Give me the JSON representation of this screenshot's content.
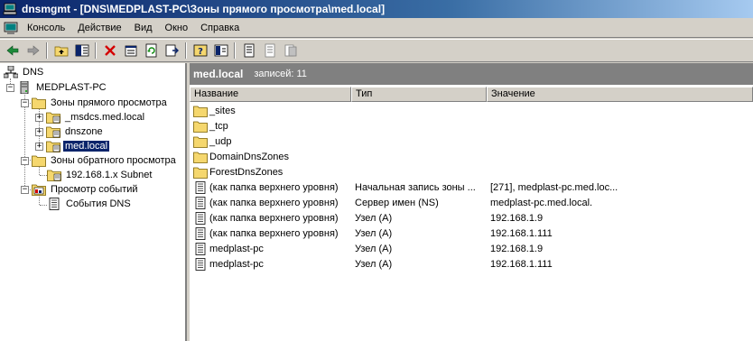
{
  "window": {
    "title": "dnsmgmt - [DNS\\MEDPLAST-PC\\Зоны прямого просмотра\\med.local]"
  },
  "menu": {
    "items": [
      "Консоль",
      "Действие",
      "Вид",
      "Окно",
      "Справка"
    ]
  },
  "toolbar": {
    "buttons": [
      "back-icon",
      "forward-icon",
      "up-folder-icon",
      "show-hide-tree-icon",
      "delete-icon",
      "properties-icon",
      "refresh-icon",
      "export-list-icon",
      "help-icon",
      "console-help-icon",
      "new-host-icon",
      "new-alias-icon",
      "new-mail-exchanger-icon"
    ]
  },
  "tree": {
    "root": "DNS",
    "server": "MEDPLAST-PC",
    "forward_zones": "Зоны прямого просмотра",
    "zone_msdcs": "_msdcs.med.local",
    "zone_dnszone": "dnszone",
    "zone_medlocal": "med.local",
    "reverse_zones": "Зоны обратного просмотра",
    "reverse_subnet": "192.168.1.x Subnet",
    "event_viewer": "Просмотр событий",
    "dns_events": "События DNS"
  },
  "details": {
    "zone": "med.local",
    "count_label": "записей: 11",
    "columns": [
      "Название",
      "Тип",
      "Значение"
    ],
    "rows": [
      {
        "name": "_sites",
        "type": "",
        "value": "",
        "icon": "folder"
      },
      {
        "name": "_tcp",
        "type": "",
        "value": "",
        "icon": "folder"
      },
      {
        "name": "_udp",
        "type": "",
        "value": "",
        "icon": "folder"
      },
      {
        "name": "DomainDnsZones",
        "type": "",
        "value": "",
        "icon": "folder"
      },
      {
        "name": "ForestDnsZones",
        "type": "",
        "value": "",
        "icon": "folder"
      },
      {
        "name": "(как папка верхнего уровня)",
        "type": "Начальная запись зоны ...",
        "value": "[271], medplast-pc.med.loc...",
        "icon": "record"
      },
      {
        "name": "(как папка верхнего уровня)",
        "type": "Сервер имен (NS)",
        "value": "medplast-pc.med.local.",
        "icon": "record"
      },
      {
        "name": "(как папка верхнего уровня)",
        "type": "Узел (A)",
        "value": "192.168.1.9",
        "icon": "record"
      },
      {
        "name": "(как папка верхнего уровня)",
        "type": "Узел (A)",
        "value": "192.168.1.111",
        "icon": "record"
      },
      {
        "name": "medplast-pc",
        "type": "Узел (A)",
        "value": "192.168.1.9",
        "icon": "record"
      },
      {
        "name": "medplast-pc",
        "type": "Узел (A)",
        "value": "192.168.1.111",
        "icon": "record"
      }
    ]
  }
}
